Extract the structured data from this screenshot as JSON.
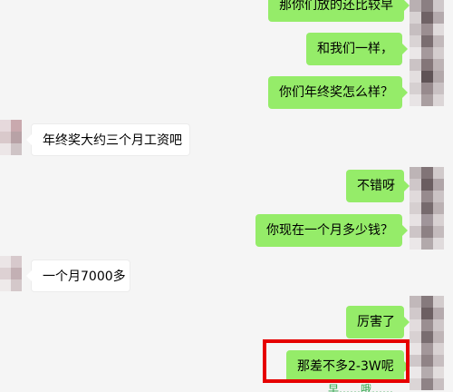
{
  "messages": {
    "m0": "那你们放的还比较早",
    "m1": "和我们一样，",
    "m2": "你们年终奖怎么样？",
    "m3": "年终奖大约三个月工资吧",
    "m4": "不错呀",
    "m5": "你现在一个月多少钱？",
    "m6": "一个月7000多",
    "m7": "厉害了",
    "m8": "那差不多2-3W呢"
  },
  "footer_partial": "早……哦……",
  "colors": {
    "self_bubble": "#95ec69",
    "other_bubble": "#ffffff",
    "background": "#f5f5f5",
    "highlight": "#e60000"
  },
  "icons": {
    "self_avatar": "pixelated-avatar",
    "other_avatar": "pixelated-avatar"
  }
}
